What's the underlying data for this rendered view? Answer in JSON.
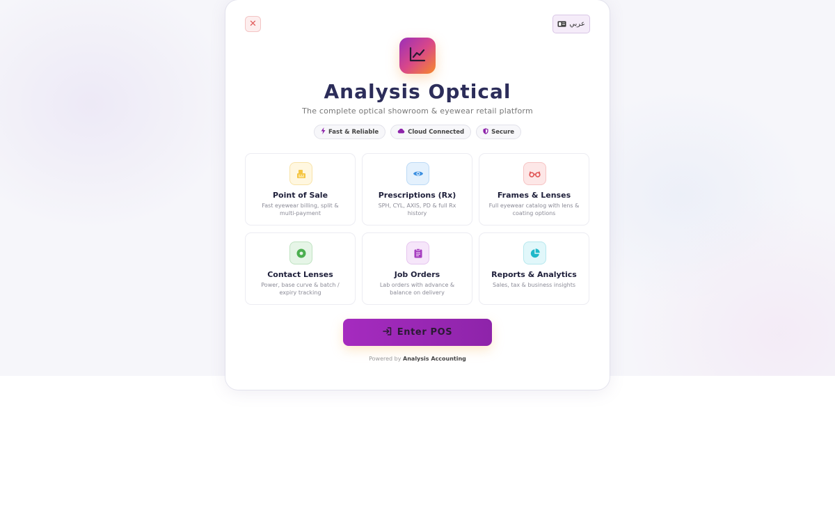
{
  "header": {
    "close_icon": "close-icon",
    "language_label": "عربي",
    "language_icon": "language-card-icon"
  },
  "brand": {
    "logo_icon": "line-chart-icon",
    "title": "Analysis Optical",
    "subtitle": "The complete optical showroom & eyewear retail platform"
  },
  "badges": [
    {
      "icon": "lightning-icon",
      "label": "Fast & Reliable"
    },
    {
      "icon": "cloud-icon",
      "label": "Cloud Connected"
    },
    {
      "icon": "shield-icon",
      "label": "Secure"
    }
  ],
  "features": [
    {
      "icon": "cash-register-icon",
      "title": "Point of Sale",
      "description": "Fast eyewear billing, split & multi-payment",
      "color": "#f5c542"
    },
    {
      "icon": "eye-icon",
      "title": "Prescriptions (Rx)",
      "description": "SPH, CYL, AXIS, PD & full Rx history",
      "color": "#3b8fe0"
    },
    {
      "icon": "glasses-icon",
      "title": "Frames & Lenses",
      "description": "Full eyewear catalog with lens & coating options",
      "color": "#e05555"
    },
    {
      "icon": "contact-lens-icon",
      "title": "Contact Lenses",
      "description": "Power, base curve & batch / expiry tracking",
      "color": "#4caf50"
    },
    {
      "icon": "clipboard-icon",
      "title": "Job Orders",
      "description": "Lab orders with advance & balance on delivery",
      "color": "#a63ec0"
    },
    {
      "icon": "pie-chart-icon",
      "title": "Reports & Analytics",
      "description": "Sales, tax & business insights",
      "color": "#1fb8c9"
    }
  ],
  "cta": {
    "icon": "sign-in-icon",
    "label": "Enter POS"
  },
  "footer": {
    "prefix": "Powered by",
    "company": "Analysis Accounting"
  }
}
